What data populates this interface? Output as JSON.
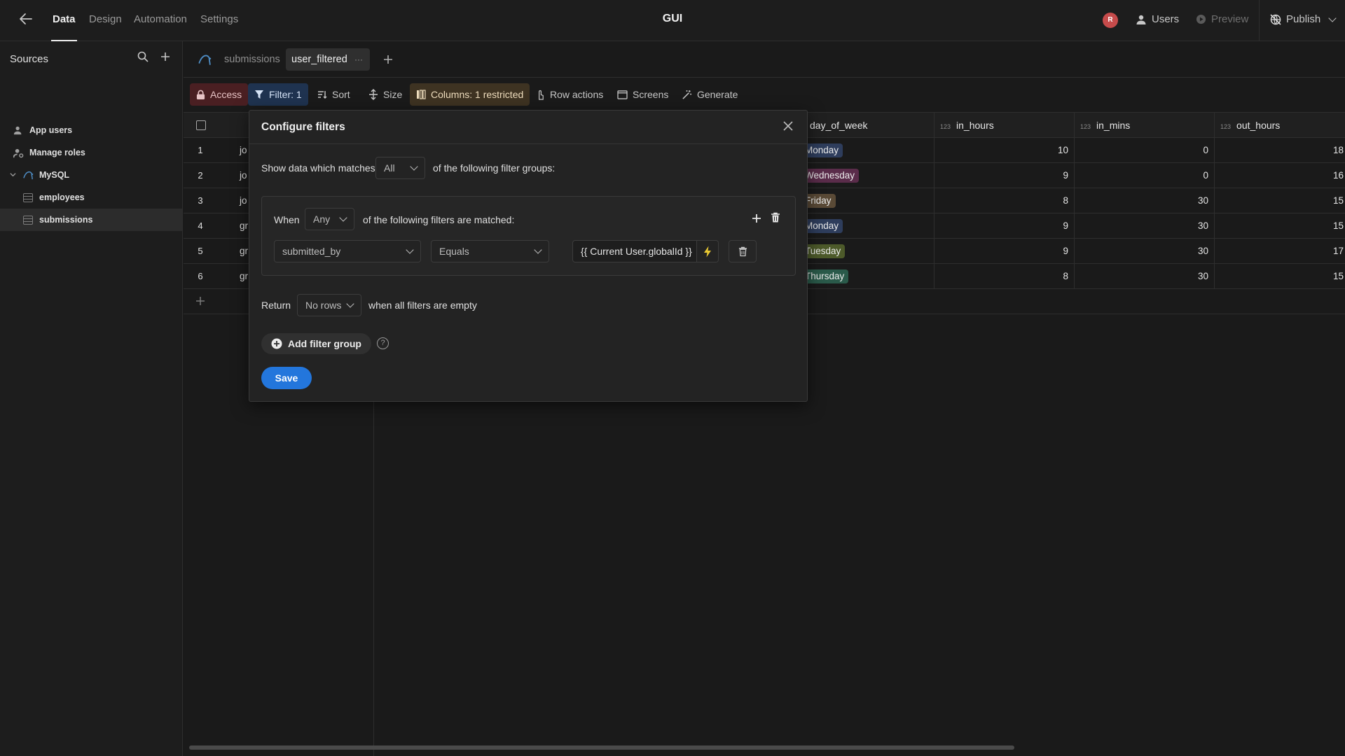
{
  "topbar": {
    "nav_tabs": [
      "Data",
      "Design",
      "Automation",
      "Settings"
    ],
    "app_title": "GUI",
    "avatar_initial": "R",
    "users_label": "Users",
    "preview_label": "Preview",
    "publish_label": "Publish"
  },
  "sidebar": {
    "title": "Sources",
    "items": [
      {
        "label": "App users",
        "icon": "user-icon"
      },
      {
        "label": "Manage roles",
        "icon": "roles-icon"
      },
      {
        "label": "MySQL",
        "icon": "mysql-icon"
      },
      {
        "label": "employees",
        "icon": "table-icon"
      },
      {
        "label": "submissions",
        "icon": "table-icon",
        "selected": true
      }
    ]
  },
  "tabs": {
    "first": "submissions",
    "active": "user_filtered",
    "more": "···"
  },
  "toolbar": {
    "access": "Access",
    "filter": "Filter: 1",
    "sort": "Sort",
    "size": "Size",
    "columns": "Columns: 1 restricted",
    "row_actions": "Row actions",
    "screens": "Screens",
    "generate": "Generate"
  },
  "grid": {
    "type_badge": "123",
    "columns": [
      "day_of_week",
      "in_hours",
      "in_mins",
      "out_hours"
    ],
    "rows": [
      {
        "num": "1",
        "frag": "jo",
        "day": "Monday",
        "day_color": "#2e3d5c",
        "in_hours": "10",
        "in_mins": "0",
        "out_frag": "18"
      },
      {
        "num": "2",
        "frag": "jo",
        "day": "Wednesday",
        "day_color": "#5a2c4a",
        "in_hours": "9",
        "in_mins": "0",
        "out_frag": "16"
      },
      {
        "num": "3",
        "frag": "jo",
        "day": "Friday",
        "day_color": "#5a4a36",
        "in_hours": "8",
        "in_mins": "30",
        "out_frag": "15"
      },
      {
        "num": "4",
        "frag": "gr",
        "day": "Monday",
        "day_color": "#2e3d5c",
        "in_hours": "9",
        "in_mins": "30",
        "out_frag": "15"
      },
      {
        "num": "5",
        "frag": "gr",
        "day": "Tuesday",
        "day_color": "#4d5a2a",
        "in_hours": "9",
        "in_mins": "30",
        "out_frag": "17"
      },
      {
        "num": "6",
        "frag": "gr",
        "day": "Thursday",
        "day_color": "#2a5a4a",
        "in_hours": "8",
        "in_mins": "30",
        "out_frag": "15"
      }
    ]
  },
  "modal": {
    "title": "Configure filters",
    "show_prefix": "Show data which matches",
    "match_value": "All",
    "show_suffix": "of the following filter groups:",
    "group": {
      "when_label": "When",
      "any_value": "Any",
      "when_suffix": "of the following filters are matched:",
      "field_value": "submitted_by",
      "operator_value": "Equals",
      "binding_value": "{{ Current User.globalId }}"
    },
    "return_label": "Return",
    "return_value": "No rows",
    "return_suffix": "when all filters are empty",
    "add_group_label": "Add filter group",
    "help_glyph": "?",
    "save_label": "Save"
  },
  "colors": {
    "accent": "#2376dc",
    "access_bg": "#4a1f22",
    "filter_bg": "#1f3350",
    "columns_bg": "#3e3322",
    "bolt": "#e8c832"
  }
}
